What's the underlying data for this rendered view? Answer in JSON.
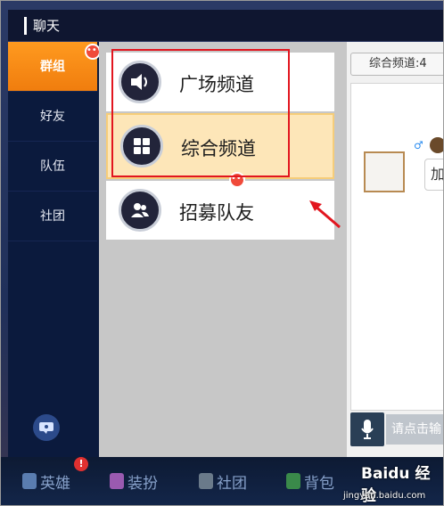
{
  "header": {
    "title": "聊天"
  },
  "sidebar": {
    "items": [
      {
        "label": "群组",
        "active": true
      },
      {
        "label": "好友",
        "active": false
      },
      {
        "label": "队伍",
        "active": false
      },
      {
        "label": "社团",
        "active": false
      }
    ],
    "badge": "•••"
  },
  "channels": {
    "items": [
      {
        "label": "广场频道",
        "icon": "speaker-icon"
      },
      {
        "label": "综合频道",
        "icon": "grid-icon",
        "selected": true
      },
      {
        "label": "招募队友",
        "icon": "users-icon"
      }
    ],
    "badge": "•••"
  },
  "chat": {
    "channel_tag": "综合频道:4",
    "gender_symbol": "♂",
    "bubble_text": "加",
    "input_placeholder": "请点击输"
  },
  "bottom_nav": {
    "items": [
      {
        "label": "英雄",
        "icon": "hero-icon"
      },
      {
        "label": "装扮",
        "icon": "outfit-icon"
      },
      {
        "label": "社团",
        "icon": "guild-icon"
      },
      {
        "label": "背包",
        "icon": "bag-icon"
      }
    ],
    "badge": "!"
  },
  "watermark": {
    "logo": "Baidu 经验",
    "url": "jingyan.baidu.com"
  },
  "colors": {
    "accent_orange": "#f07d0e",
    "annotation_red": "#e2161f",
    "selected_bg": "#fde6b8"
  }
}
